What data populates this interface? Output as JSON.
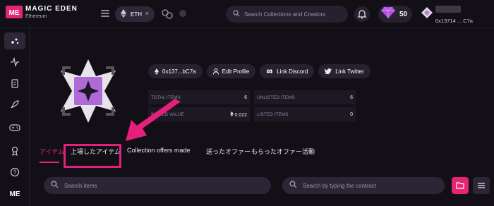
{
  "header": {
    "brand": "MAGIC EDEN",
    "network": "Ethereum",
    "chain_label": "ETH",
    "chain_close": "×",
    "search_placeholder": "Search Collections and Creators",
    "gems_count": "50",
    "account_address": "0x13714 ... C7a"
  },
  "sidebar": {
    "items": [
      {
        "icon": "explore-icon",
        "active": true
      },
      {
        "icon": "activity-icon"
      },
      {
        "icon": "clipboard-icon"
      },
      {
        "icon": "rocket-icon"
      },
      {
        "icon": "gamepad-icon"
      },
      {
        "icon": "award-icon"
      },
      {
        "icon": "help-icon"
      },
      {
        "icon": "magic-eden-logo-icon"
      }
    ]
  },
  "profile": {
    "wallet_chip": "0x137...bC7a",
    "edit_profile": "Edit Profile",
    "link_discord": "Link Discord",
    "link_twitter": "Link Twitter",
    "stats": {
      "total_items_label": "TOTAL ITEMS",
      "total_items_value": "6",
      "unlisted_items_label": "UNLISTED ITEMS",
      "unlisted_items_value": "6",
      "estimated_value_label": "IMATED VALUE",
      "estimated_value_value": "0.022",
      "listed_items_label": "LISTED ITEMS",
      "listed_items_value": "0"
    }
  },
  "tabs": [
    {
      "label": "アイテム",
      "active": true
    },
    {
      "label": "上場したアイテム"
    },
    {
      "label": "Collection offers made"
    },
    {
      "label": "送ったオファー"
    },
    {
      "label": "もらったオファー"
    },
    {
      "label": "活動"
    }
  ],
  "filters": {
    "items_search_placeholder": "Search items",
    "contract_search_placeholder": "Search by typing the contract"
  },
  "colors": {
    "accent": "#e42575",
    "highlight": "#e51f7a",
    "background": "#120f17"
  }
}
